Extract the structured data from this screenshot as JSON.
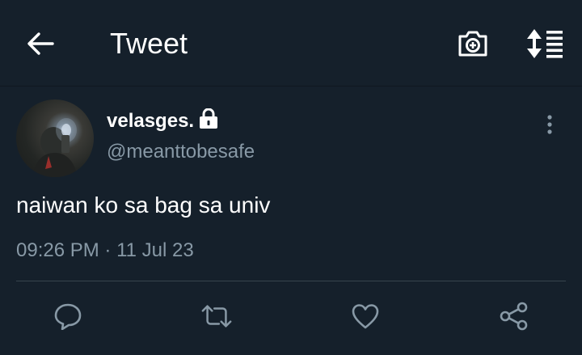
{
  "header": {
    "title": "Tweet",
    "back_icon": "arrow-left-icon",
    "camera_icon": "camera-plus-icon",
    "sort_icon": "sort-list-icon"
  },
  "tweet": {
    "display_name": "velasges.",
    "username": "@meanttobesafe",
    "text": "naiwan ko sa bag sa univ",
    "time": "09:26 PM",
    "separator": "·",
    "date": "11 Jul 23",
    "protected_icon": "lock-icon",
    "more_icon": "more-vertical-icon"
  },
  "actions": [
    {
      "name": "reply",
      "icon": "reply-icon"
    },
    {
      "name": "retweet",
      "icon": "retweet-icon"
    },
    {
      "name": "like",
      "icon": "heart-icon"
    },
    {
      "name": "share",
      "icon": "share-icon"
    }
  ],
  "colors": {
    "background": "#15202b",
    "text_primary": "#ffffff",
    "text_secondary": "#8899a6",
    "divider": "#38444d"
  }
}
